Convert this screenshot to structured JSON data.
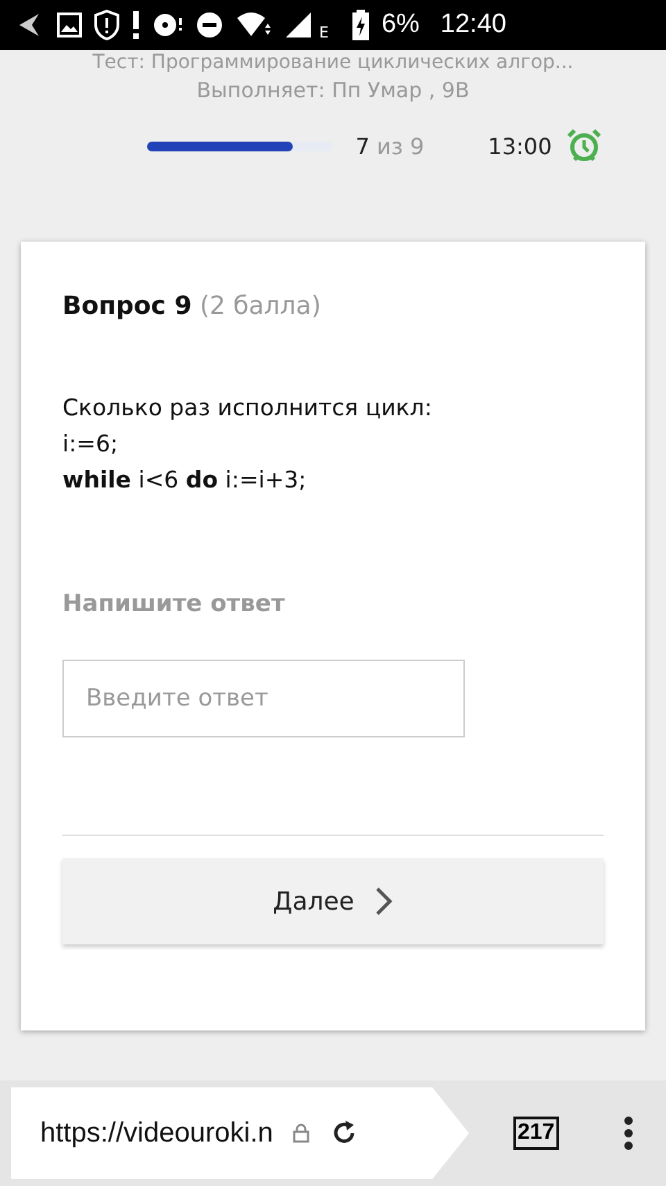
{
  "status_bar": {
    "network_type": "E",
    "battery": "6%",
    "time": "12:40"
  },
  "header": {
    "title": "Тест: Программирование циклических алгор...",
    "performer": "Выполняет: Пп Умар , 9В",
    "progress": {
      "level": 0.78,
      "current": "7",
      "of": "из 9"
    },
    "timer": "13:00"
  },
  "question": {
    "title": "Вопрос 9",
    "points": "(2 балла)",
    "lines": [
      "Сколько раз исполнится цикл:",
      "i:=6;",
      "**while** i<6 **do** i:=i+3;"
    ],
    "answer_label": "Напишите ответ",
    "answer_field": {
      "placeholder": "Введите ответ"
    },
    "next_button": "Далее"
  },
  "browser_bar": {
    "url": "https://videouroki.n",
    "tabs_count": "217"
  }
}
